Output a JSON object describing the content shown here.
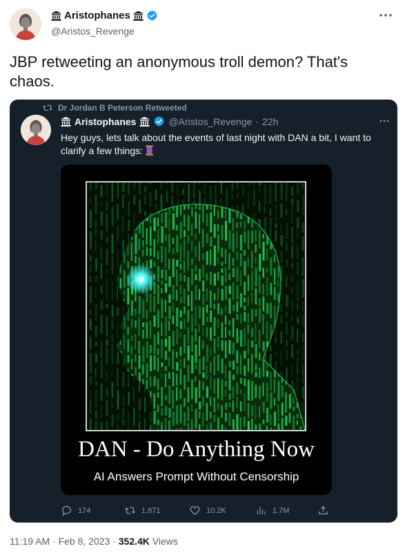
{
  "author": {
    "name": "Aristophanes",
    "handle": "@Aristos_Revenge"
  },
  "tweet": {
    "text": "JBP retweeting an anonymous troll demon? That's chaos."
  },
  "retweet": {
    "label": "Dr Jordan B Peterson Retweeted",
    "name": "Aristophanes",
    "handle": "@Aristos_Revenge",
    "separator": "·",
    "age": "22h",
    "text": "Hey guys, lets talk about the events of last night with DAN a bit, I want to clarify a few things:",
    "media": {
      "title": "DAN - Do Anything Now",
      "subtitle": "AI Answers Prompt Without Censorship"
    },
    "actions": {
      "replies": "174",
      "retweets": "1,871",
      "likes": "10.2K",
      "views": "1.7M"
    }
  },
  "meta": {
    "time": "11:19 AM",
    "separator": "·",
    "date": "Feb 8, 2023",
    "views_count": "352.4K",
    "views_label": "Views"
  },
  "colors": {
    "card_bg": "#15202b",
    "verified": "#1d9bf0",
    "matrix_green": "#1fd35a",
    "eye_glow": "#4ff7ff"
  },
  "icons": [
    "temple-icon",
    "verified-badge-icon",
    "more-icon",
    "retweet-icon",
    "thread-spool-icon",
    "reply-icon",
    "like-icon",
    "views-icon",
    "share-icon"
  ]
}
